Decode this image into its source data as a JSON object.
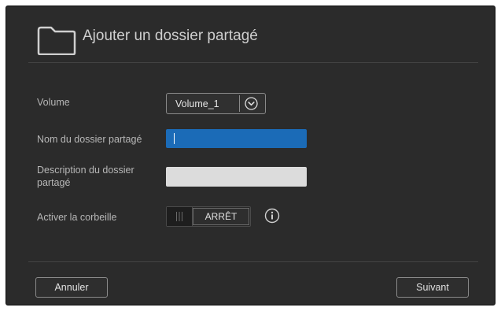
{
  "dialog": {
    "title": "Ajouter un dossier partagé",
    "icon": "folder-icon"
  },
  "form": {
    "volume": {
      "label": "Volume",
      "selected": "Volume_1",
      "icon": "chevron-down-icon"
    },
    "share_name": {
      "label": "Nom du dossier partagé",
      "value": ""
    },
    "share_description": {
      "label": "Description du dossier partagé",
      "value": ""
    },
    "recycle_bin": {
      "label": "Activer la corbeille",
      "state_label": "ARRÊT",
      "info_icon": "info-icon"
    }
  },
  "footer": {
    "cancel_label": "Annuler",
    "next_label": "Suivant"
  },
  "colors": {
    "background": "#2b2b2b",
    "focused_input": "#1b6bb7",
    "text": "#b7b7b7"
  }
}
